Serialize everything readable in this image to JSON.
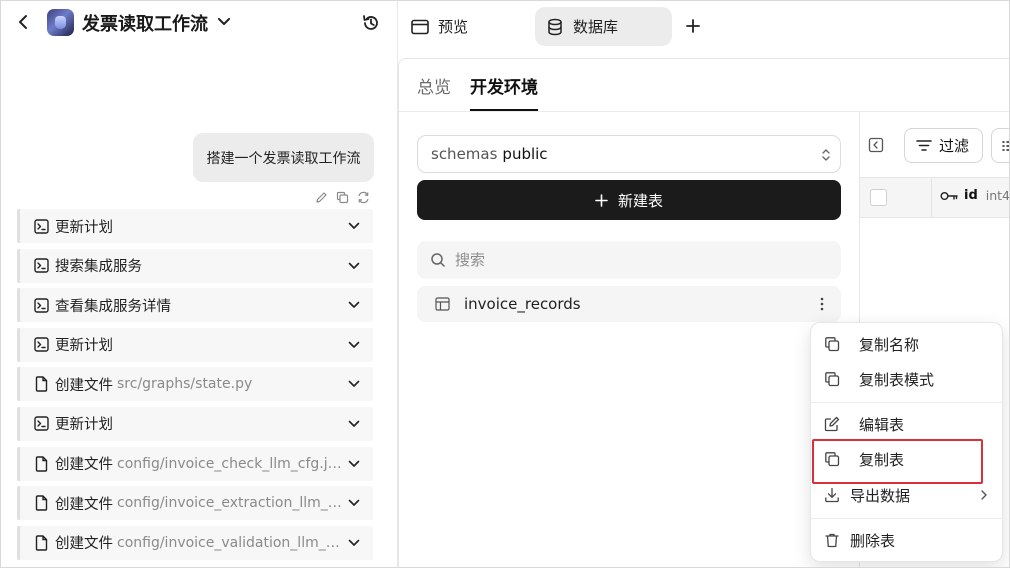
{
  "header": {
    "app_title": "发票读取工作流"
  },
  "chat": {
    "user_message": "搭建一个发票读取工作流",
    "steps": [
      {
        "icon": "terminal-icon",
        "label": "更新计划",
        "path": ""
      },
      {
        "icon": "terminal-icon",
        "label": "搜索集成服务",
        "path": ""
      },
      {
        "icon": "terminal-icon",
        "label": "查看集成服务详情",
        "path": ""
      },
      {
        "icon": "terminal-icon",
        "label": "更新计划",
        "path": ""
      },
      {
        "icon": "file-icon",
        "label": "创建文件",
        "path": "src/graphs/state.py"
      },
      {
        "icon": "terminal-icon",
        "label": "更新计划",
        "path": ""
      },
      {
        "icon": "file-icon",
        "label": "创建文件",
        "path": "config/invoice_check_llm_cfg.json"
      },
      {
        "icon": "file-icon",
        "label": "创建文件",
        "path": "config/invoice_extraction_llm_cfg.json"
      },
      {
        "icon": "file-icon",
        "label": "创建文件",
        "path": "config/invoice_validation_llm_cfg.json"
      }
    ]
  },
  "top_tabs": {
    "preview_label": "预览",
    "database_label": "数据库"
  },
  "db": {
    "env_tabs": {
      "overview": "总览",
      "dev": "开发环境"
    },
    "schema_key": "schemas",
    "schema_value": "public",
    "new_table_label": "新建表",
    "search_placeholder": "搜索",
    "tables": [
      "invoice_records"
    ]
  },
  "grid": {
    "filter_label": "过滤",
    "column": {
      "name": "id",
      "type": "int4"
    }
  },
  "context_menu": {
    "copy_name": "复制名称",
    "copy_schema": "复制表模式",
    "edit_table": "编辑表",
    "duplicate_table": "复制表",
    "export_data": "导出数据",
    "delete_table": "删除表"
  },
  "colors": {
    "primary_button": "#1b1b1b",
    "highlight_box": "#d9303a",
    "active_tab_bg": "#ececec"
  }
}
